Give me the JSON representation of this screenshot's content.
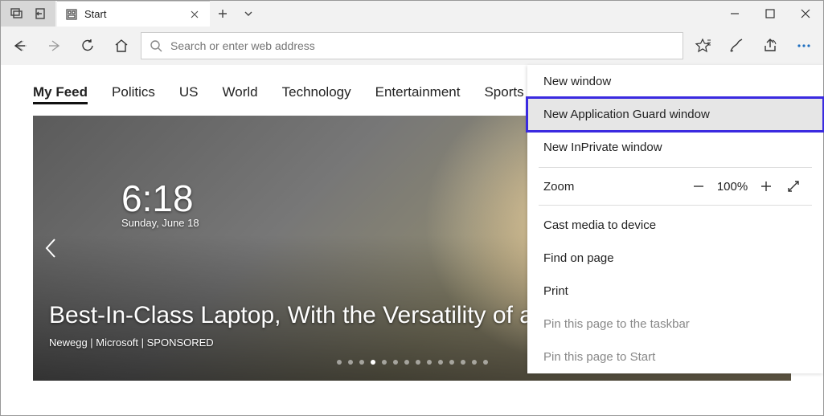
{
  "titlebar": {
    "tab_title": "Start",
    "address_placeholder": "Search or enter web address"
  },
  "feed": {
    "items": [
      "My Feed",
      "Politics",
      "US",
      "World",
      "Technology",
      "Entertainment",
      "Sports"
    ],
    "active_index": 0
  },
  "hero": {
    "device_time": "6:18",
    "device_date": "Sunday, June 18",
    "headline": "Best-In-Class Laptop, With the Versatility of a Studio & Tablet",
    "source": "Newegg | Microsoft | SPONSORED",
    "dot_count": 14,
    "dot_active": 3
  },
  "menu": {
    "new_window": "New window",
    "app_guard": "New Application Guard window",
    "inprivate": "New InPrivate window",
    "zoom_label": "Zoom",
    "zoom_pct": "100%",
    "cast": "Cast media to device",
    "find": "Find on page",
    "print": "Print",
    "pin_taskbar": "Pin this page to the taskbar",
    "pin_start": "Pin this page to Start"
  }
}
